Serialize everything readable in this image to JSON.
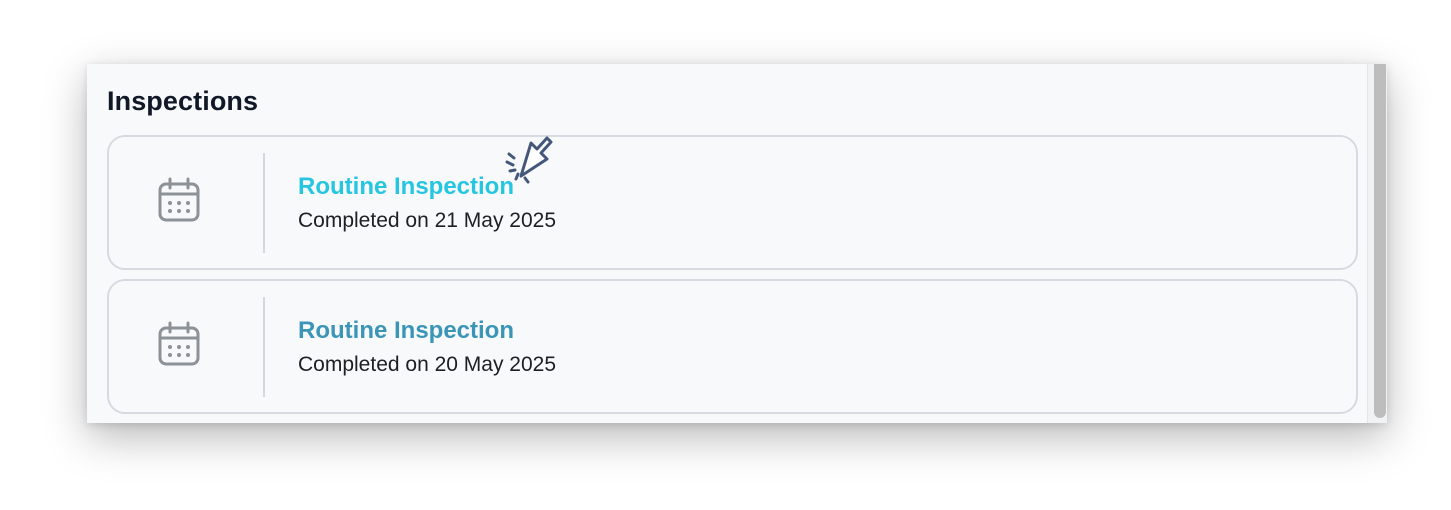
{
  "section": {
    "title": "Inspections"
  },
  "inspections": [
    {
      "title": "Routine Inspection",
      "status": "Completed on 21 May 2025",
      "icon": "calendar-icon",
      "hovered": true
    },
    {
      "title": "Routine Inspection",
      "status": "Completed on 20 May 2025",
      "icon": "calendar-icon",
      "hovered": false
    }
  ],
  "colors": {
    "link": "#3b95b7",
    "link_hover": "#27c6e0",
    "text": "#1c1f24",
    "heading": "#111827",
    "icon": "#8d9198"
  },
  "cursor": {
    "icon": "click-cursor-icon"
  }
}
